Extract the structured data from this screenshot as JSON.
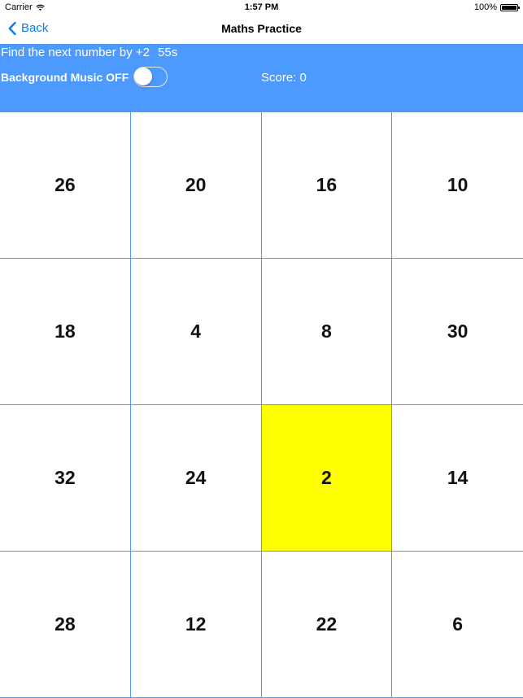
{
  "status_bar": {
    "carrier": "Carrier",
    "time": "1:57 PM",
    "battery": "100%"
  },
  "nav": {
    "back_label": "Back",
    "title": "Maths Practice"
  },
  "info": {
    "instruction": "Find the next number by +2",
    "timer": "55s",
    "music_label": "Background Music OFF",
    "music_on": false,
    "score": "Score: 0"
  },
  "colors": {
    "accent": "#4d9aff",
    "highlight": "#ffff00",
    "link": "#0a7aff"
  },
  "grid": {
    "cells": [
      "26",
      "20",
      "16",
      "10",
      "18",
      "4",
      "8",
      "30",
      "32",
      "24",
      "2",
      "14",
      "28",
      "12",
      "22",
      "6"
    ],
    "highlighted": "2"
  }
}
